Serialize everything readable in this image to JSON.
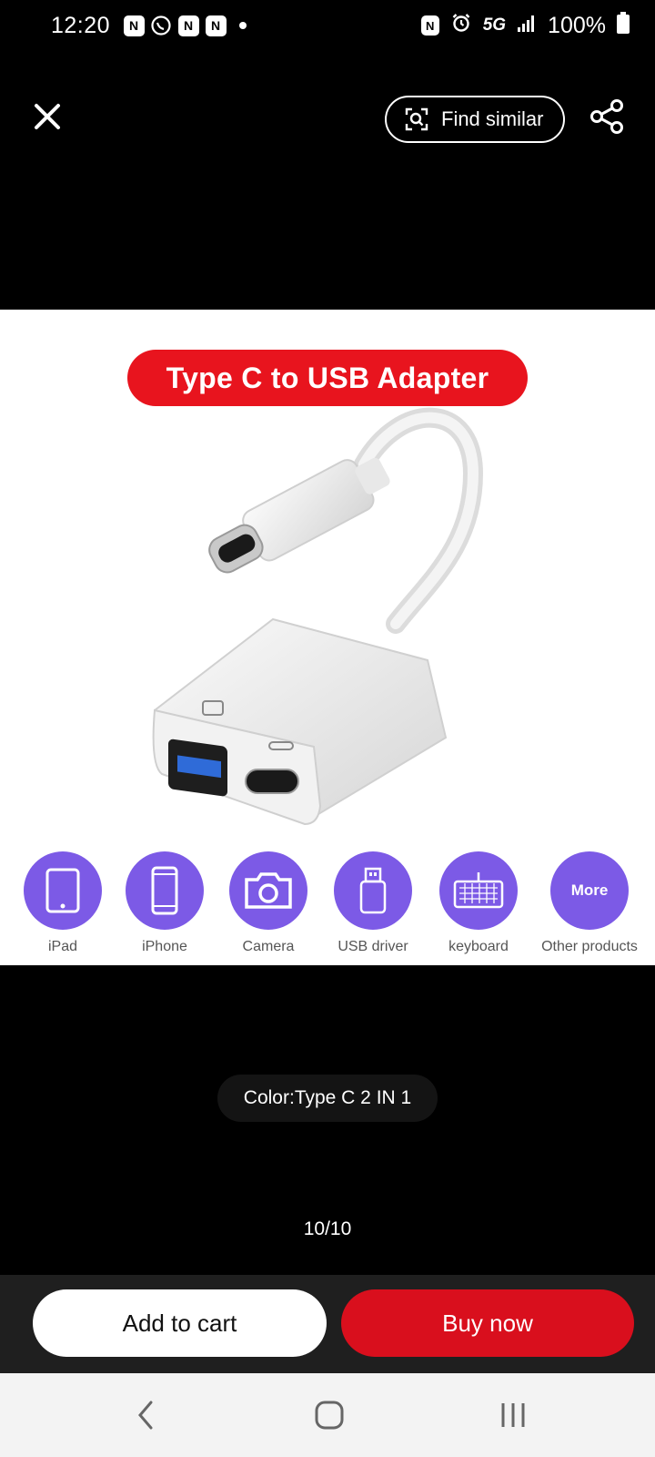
{
  "status_bar": {
    "time": "12:20",
    "network": "5G",
    "battery": "100%"
  },
  "header": {
    "find_similar_label": "Find similar"
  },
  "product_image": {
    "banner_text": "Type C to USB Adapter",
    "compat": [
      {
        "label": "iPad",
        "icon": "tablet-icon"
      },
      {
        "label": "iPhone",
        "icon": "phone-icon"
      },
      {
        "label": "Camera",
        "icon": "camera-icon"
      },
      {
        "label": "USB driver",
        "icon": "usb-drive-icon"
      },
      {
        "label": "keyboard",
        "icon": "keyboard-icon"
      },
      {
        "label": "Other products",
        "icon": "more-icon",
        "circle_text": "More"
      }
    ]
  },
  "variant": {
    "color_label": "Color:Type C 2 IN 1"
  },
  "gallery": {
    "counter": "10/10"
  },
  "actions": {
    "add_to_cart": "Add to cart",
    "buy_now": "Buy now"
  },
  "colors": {
    "accent_red": "#d90f1d",
    "icon_purple": "#7c5ae6"
  }
}
